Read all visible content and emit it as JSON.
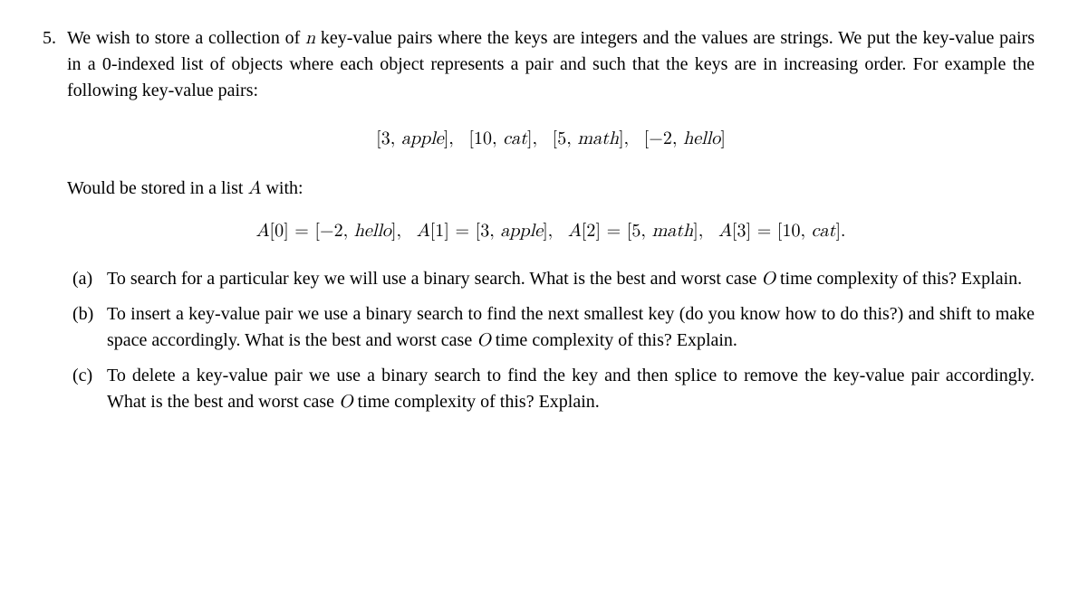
{
  "problem": {
    "number": "5.",
    "intro_pre": "We wish to store a collection of ",
    "intro_var": "n",
    "intro_post": " key-value pairs where the keys are integers and the values are strings. We put the key-value pairs in a 0-indexed list of objects where each object represents a pair and such that the keys are in increasing order. For example the following key-value pairs:",
    "pairs_display": "[3, apple], [10, cat], [5, math], [−2, hello]",
    "mid_line_pre": "Would be stored in a list ",
    "mid_line_var": "A",
    "mid_line_post": " with:",
    "sorted_display": "A[0] = [−2, hello], A[1] = [3, apple], A[2] = [5, math], A[3] = [10, cat].",
    "parts": [
      {
        "label": "(a)",
        "body_pre": "To search for a particular key we will use a binary search. What is the best and worst case ",
        "bigO": "O",
        "body_post": " time complexity of this? Explain."
      },
      {
        "label": "(b)",
        "body_pre": "To insert a key-value pair we use a binary search to find the next smallest key (do you know how to do this?) and shift to make space accordingly. What is the best and worst case ",
        "bigO": "O",
        "body_post": " time complexity of this? Explain."
      },
      {
        "label": "(c)",
        "body_pre": "To delete a key-value pair we use a binary search to find the key and then splice to remove the key-value pair accordingly. What is the best and worst case ",
        "bigO": "O",
        "body_post": " time complexity of this? Explain."
      }
    ]
  }
}
